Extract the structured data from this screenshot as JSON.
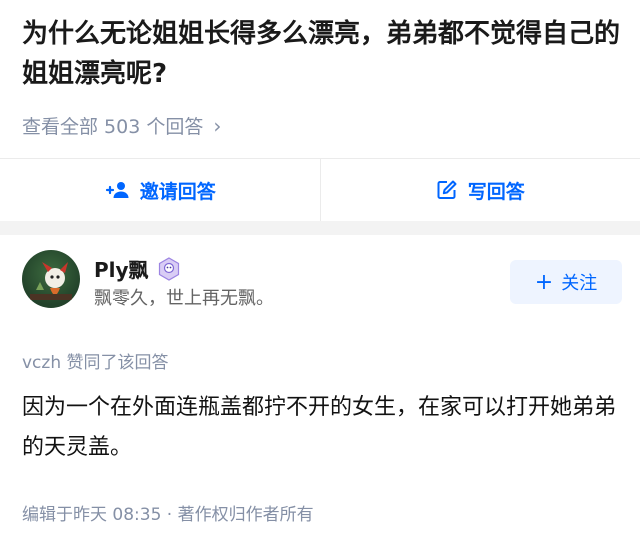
{
  "question": {
    "title": "为什么无论姐姐长得多么漂亮，弟弟都不觉得自己的姐姐漂亮呢?",
    "view_all": "查看全部 503 个回答"
  },
  "actions": {
    "invite_label": "邀请回答",
    "write_label": "写回答",
    "accent": "#0066ff"
  },
  "author": {
    "name": "Ply飘",
    "bio": "飘零久，世上再无飘。",
    "follow_label": "关注"
  },
  "answer": {
    "voter_line": "vczh 赞同了该回答",
    "text": "因为一个在外面连瓶盖都拧不开的女生，在家可以打开她弟弟的天灵盖。",
    "meta": "编辑于昨天 08:35 · 著作权归作者所有"
  }
}
